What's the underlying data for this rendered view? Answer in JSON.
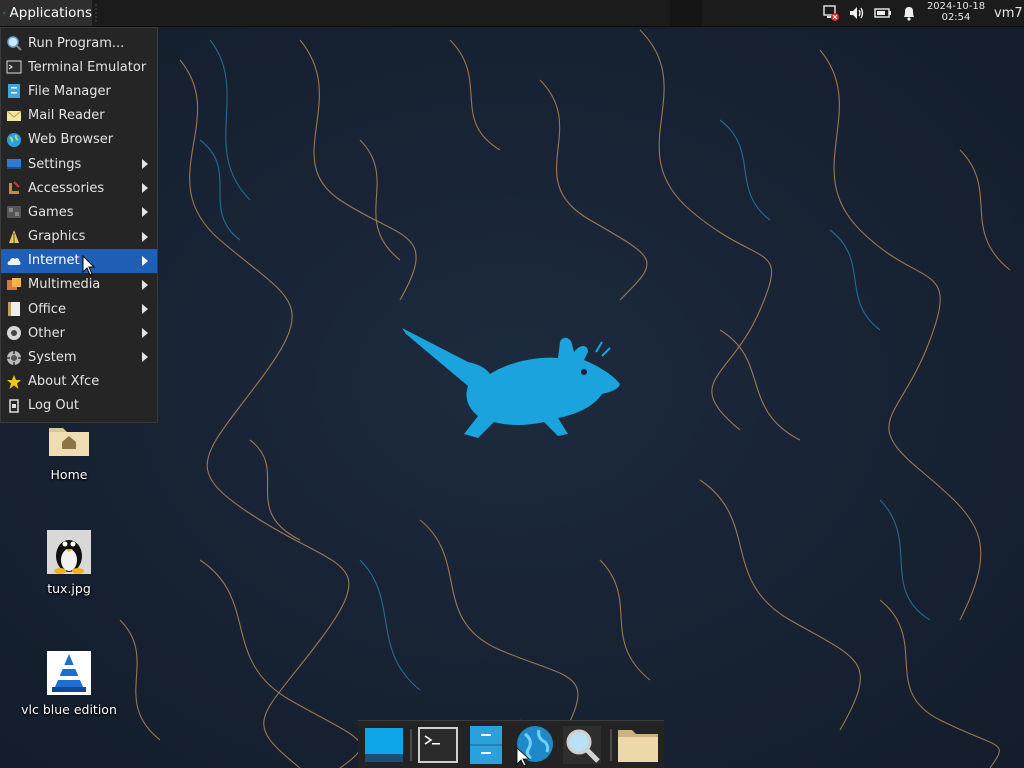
{
  "panel": {
    "apps_button_label": "Applications",
    "clock_date": "2024-10-18",
    "clock_time": "02:54",
    "user": "vm7",
    "tray_icons": [
      "network-disconnected-icon",
      "volume-icon",
      "battery-icon",
      "notification-bell-icon"
    ]
  },
  "menu": {
    "items": [
      {
        "label": "Run Program...",
        "icon": "run-program-icon",
        "submenu": false
      },
      {
        "label": "Terminal Emulator",
        "icon": "terminal-icon",
        "submenu": false
      },
      {
        "label": "File Manager",
        "icon": "file-manager-icon",
        "submenu": false
      },
      {
        "label": "Mail Reader",
        "icon": "mail-icon",
        "submenu": false
      },
      {
        "label": "Web Browser",
        "icon": "web-browser-icon",
        "submenu": false
      },
      {
        "label": "Settings",
        "icon": "settings-icon",
        "submenu": true
      },
      {
        "label": "Accessories",
        "icon": "accessories-icon",
        "submenu": true
      },
      {
        "label": "Games",
        "icon": "games-icon",
        "submenu": true
      },
      {
        "label": "Graphics",
        "icon": "graphics-icon",
        "submenu": true
      },
      {
        "label": "Internet",
        "icon": "internet-icon",
        "submenu": true,
        "highlighted": true
      },
      {
        "label": "Multimedia",
        "icon": "multimedia-icon",
        "submenu": true
      },
      {
        "label": "Office",
        "icon": "office-icon",
        "submenu": true
      },
      {
        "label": "Other",
        "icon": "other-icon",
        "submenu": true
      },
      {
        "label": "System",
        "icon": "system-icon",
        "submenu": true
      },
      {
        "label": "About Xfce",
        "icon": "star-icon",
        "submenu": false
      },
      {
        "label": "Log Out",
        "icon": "logout-icon",
        "submenu": false
      }
    ]
  },
  "desktop": {
    "icons": [
      {
        "label": "Home",
        "icon": "home-folder-icon"
      },
      {
        "label": "tux.jpg",
        "icon": "tux-image-icon"
      },
      {
        "label": "vlc blue edition",
        "icon": "vlc-icon"
      }
    ]
  },
  "dock": {
    "items": [
      "show-desktop-icon",
      "terminal-icon",
      "file-manager-icon",
      "web-browser-icon",
      "app-finder-icon",
      "folder-icon"
    ]
  },
  "colors": {
    "menu_highlight": "#1f5fb5",
    "panel_bg": "#1b1b1b",
    "wallpaper_bg": "#172233",
    "mouse_logo": "#1aa3dc"
  }
}
